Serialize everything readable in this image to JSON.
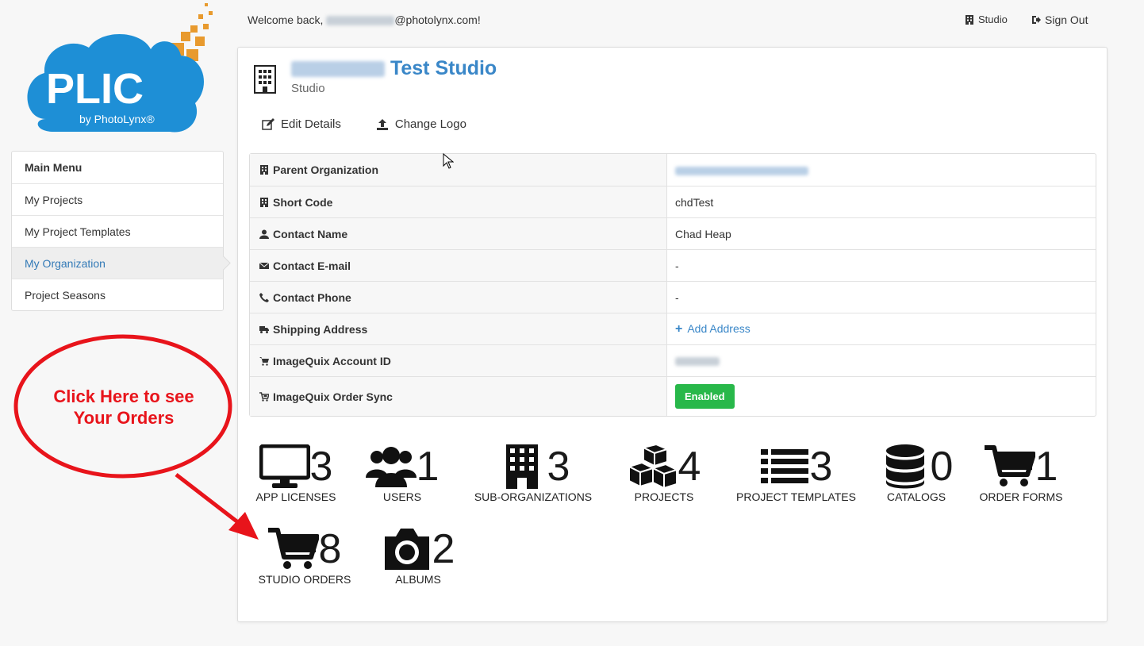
{
  "logo": {
    "text": "PLIC",
    "byline": "by PhotoLynx®"
  },
  "header": {
    "welcome_prefix": "Welcome back, ",
    "welcome_suffix": "@photolynx.com!",
    "studio_link": "Studio",
    "sign_out": "Sign Out"
  },
  "sidebar": {
    "title": "Main Menu",
    "items": [
      {
        "label": "My Projects"
      },
      {
        "label": "My Project Templates"
      },
      {
        "label": "My Organization"
      },
      {
        "label": "Project Seasons"
      }
    ]
  },
  "org": {
    "name_visible": "Test Studio",
    "type": "Studio",
    "edit_details": "Edit Details",
    "change_logo": "Change Logo"
  },
  "details": {
    "parent_org": {
      "label": "Parent Organization"
    },
    "short_code": {
      "label": "Short Code",
      "value": "chdTest"
    },
    "contact_name": {
      "label": "Contact Name",
      "value": "Chad Heap"
    },
    "contact_email": {
      "label": "Contact E-mail",
      "value": "-"
    },
    "contact_phone": {
      "label": "Contact Phone",
      "value": "-"
    },
    "shipping_address": {
      "label": "Shipping Address",
      "value": "Add Address"
    },
    "imagequix_account": {
      "label": "ImageQuix Account ID"
    },
    "imagequix_sync": {
      "label": "ImageQuix Order Sync",
      "value": "Enabled"
    }
  },
  "stats": [
    {
      "label": "APP LICENSES",
      "count": "3",
      "icon": "monitor-icon"
    },
    {
      "label": "USERS",
      "count": "1",
      "icon": "users-icon"
    },
    {
      "label": "SUB-ORGANIZATIONS",
      "count": "3",
      "icon": "building-icon"
    },
    {
      "label": "PROJECTS",
      "count": "4",
      "icon": "cubes-icon"
    },
    {
      "label": "PROJECT TEMPLATES",
      "count": "3",
      "icon": "list-icon"
    },
    {
      "label": "CATALOGS",
      "count": "0",
      "icon": "database-icon"
    },
    {
      "label": "ORDER FORMS",
      "count": "1",
      "icon": "cart-icon"
    },
    {
      "label": "STUDIO ORDERS",
      "count": "8",
      "icon": "cart-icon"
    },
    {
      "label": "ALBUMS",
      "count": "2",
      "icon": "camera-icon"
    }
  ],
  "annotation": {
    "line1": "Click Here to see",
    "line2": "Your Orders"
  },
  "colors": {
    "accent": "#3a87c8",
    "success": "#28b84a",
    "annotation": "#e8141b",
    "logo_blue": "#1e8fd6",
    "logo_orange": "#e89a2e"
  }
}
